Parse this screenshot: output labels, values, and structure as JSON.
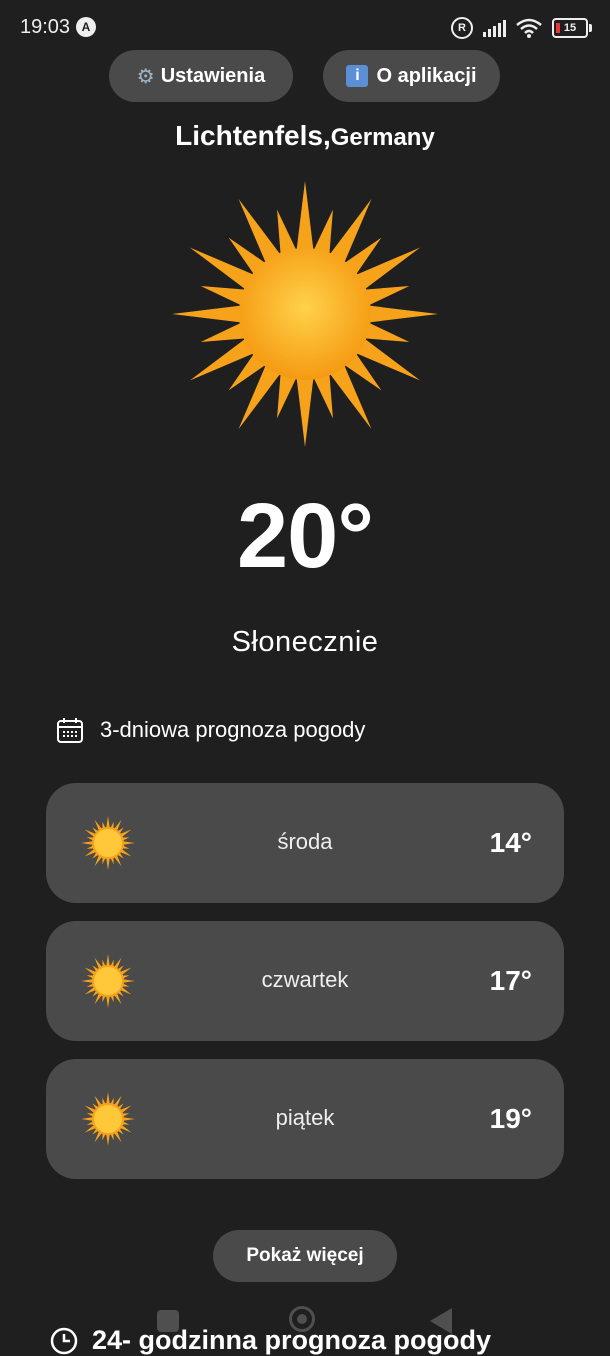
{
  "status_bar": {
    "time": "19:03",
    "app_badge": "A",
    "registered_badge": "R",
    "battery": "15"
  },
  "header": {
    "settings_label": "Ustawienia",
    "settings_icon": "gear-icon",
    "about_label": "O aplikacji",
    "about_icon": "info-icon"
  },
  "location": {
    "city": "Lichtenfels,",
    "country": "Germany"
  },
  "current": {
    "temperature": "20°",
    "condition": "Słonecznie",
    "icon": "sun-icon"
  },
  "forecast": {
    "title": "3-dniowa prognoza pogody",
    "icon": "calendar-icon",
    "days": [
      {
        "name": "środa",
        "temp": "14°",
        "icon": "sun-icon"
      },
      {
        "name": "czwartek",
        "temp": "17°",
        "icon": "sun-icon"
      },
      {
        "name": "piątek",
        "temp": "19°",
        "icon": "sun-icon"
      }
    ],
    "more_label": "Pokaż więcej"
  },
  "hourly": {
    "title": "24- godzinna prognoza pogody",
    "icon": "clock-icon"
  },
  "colors": {
    "background": "#1f1f1f",
    "card": "#4a4a4a",
    "sun_core": "#ffc83a",
    "sun_ray": "#f7a21b"
  }
}
